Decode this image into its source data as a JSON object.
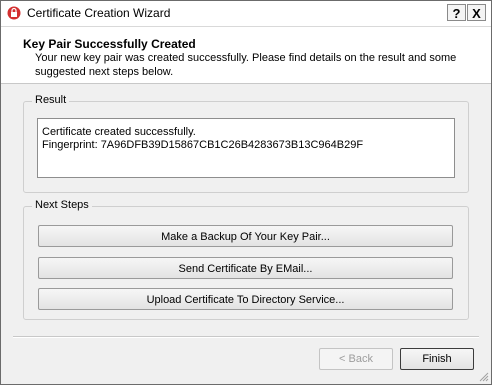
{
  "window": {
    "title": "Certificate Creation Wizard",
    "help_label": "?",
    "close_label": "X"
  },
  "header": {
    "title": "Key Pair Successfully Created",
    "description": "Your new key pair was created successfully. Please find details on the result and some suggested next steps below."
  },
  "result": {
    "group_label": "Result",
    "line1": "Certificate created successfully.",
    "line2": "Fingerprint: 7A96DFB39D15867CB1C26B4283673B13C964B29F"
  },
  "next_steps": {
    "group_label": "Next Steps",
    "backup_label": "Make a Backup Of Your Key Pair...",
    "email_label": "Send Certificate By EMail...",
    "upload_label": "Upload Certificate To Directory Service..."
  },
  "footer": {
    "back_label": "< Back",
    "finish_label": "Finish"
  },
  "icons": {
    "app": "certificate-app-icon",
    "help": "help-icon",
    "close": "close-icon"
  },
  "colors": {
    "app_icon": "#d32f2f",
    "disabled_text": "#9d9d9d"
  }
}
